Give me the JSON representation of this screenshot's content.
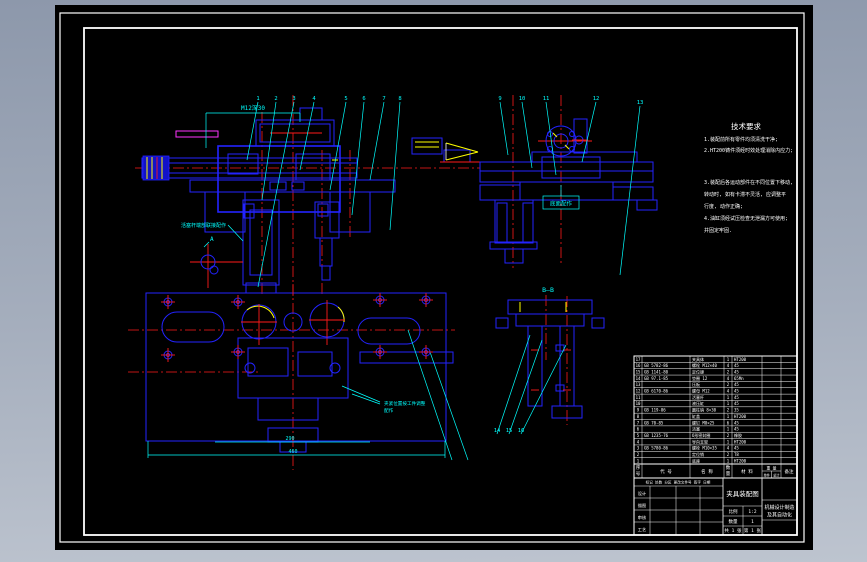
{
  "window": {
    "background_top": "#8d98ab",
    "background_bottom": "#bdc4cf",
    "paper": "#000000"
  },
  "palette": {
    "outline": "#2323ff",
    "centerline": "#ff1a1a",
    "dimension": "#00ffff",
    "highlight": "#ffff00",
    "special": "#ff33ff",
    "frame": "#ffffff",
    "hatch": "#00e0a8"
  },
  "notes": {
    "title": "技术要求",
    "lines": [
      "1.装配前所有零件均须清洗干净;",
      "2.HT200铸件须经时效处理消除内应力;",
      "3.装配后各运动部件在不同位置下移动,",
      "  转动时, 如有卡滞不灵活, 应调整平",
      "  行度, 动作正确;",
      "4.油缸须经试压检查无泄漏方可使用;",
      "  并固定牢固."
    ]
  },
  "labels": {
    "front_top_dim": "M12深30",
    "front_leader": "活塞杆端部联接配作",
    "detail_mark": "A",
    "section_label": "B—B",
    "side_box": "底面配作",
    "plan_leader_1": "夹紧位置按工件调整",
    "plan_leader_2": "配作",
    "plan_dim_inner": "290",
    "plan_dim_overall": "460"
  },
  "balloons": {
    "front": [
      "1",
      "2",
      "3",
      "4",
      "5",
      "6",
      "7",
      "8"
    ],
    "side": [
      "9",
      "10",
      "11",
      "12",
      "13"
    ],
    "section": [
      "14",
      "15",
      "16"
    ]
  },
  "bom": {
    "headers": [
      "序号",
      "代 号",
      "名 称",
      "数量",
      "材 料",
      "重 量",
      "备注"
    ],
    "weight_sub": [
      "单件",
      "总计"
    ],
    "rows": [
      [
        "17",
        "",
        "夹具体",
        "1",
        "HT200",
        ""
      ],
      [
        "16",
        "GB 5782-86",
        "螺栓 M12×40",
        "4",
        "45",
        ""
      ],
      [
        "15",
        "GB 1141-80",
        "定位键",
        "2",
        "45",
        ""
      ],
      [
        "14",
        "GB 97.1-85",
        "垫圈 12",
        "4",
        "65Mn",
        ""
      ],
      [
        "13",
        "",
        "压板",
        "2",
        "45",
        ""
      ],
      [
        "12",
        "GB 6170-86",
        "螺母 M12",
        "4",
        "45",
        ""
      ],
      [
        "11",
        "",
        "活塞杆",
        "1",
        "45",
        ""
      ],
      [
        "10",
        "",
        "液压缸",
        "1",
        "45",
        ""
      ],
      [
        "9",
        "GB 119-86",
        "圆柱销 8×30",
        "2",
        "35",
        ""
      ],
      [
        "8",
        "",
        "缸盖",
        "1",
        "HT200",
        ""
      ],
      [
        "7",
        "GB 70-85",
        "螺钉 M8×25",
        "6",
        "45",
        ""
      ],
      [
        "6",
        "",
        "活塞",
        "1",
        "45",
        ""
      ],
      [
        "5",
        "GB 1235-76",
        "O形密封圈",
        "2",
        "橡胶",
        ""
      ],
      [
        "4",
        "",
        "导向支架",
        "1",
        "HT200",
        ""
      ],
      [
        "3",
        "GB 5780-86",
        "螺栓 M10×35",
        "4",
        "45",
        ""
      ],
      [
        "2",
        "",
        "定位销",
        "2",
        "T8",
        ""
      ],
      [
        "1",
        "",
        "底座",
        "1",
        "HT200",
        ""
      ]
    ]
  },
  "titleblock": {
    "rev_header": "标记 处数 分区 更改文件号 签字 日期",
    "sign_rows": [
      "设计",
      "描图",
      "审核",
      "工艺"
    ],
    "drawing_title": "夹具装配图",
    "scale_label": "比例",
    "scale": "1:2",
    "qty_label": "数量",
    "qty": "1",
    "sheets": "共 1 张",
    "sheet_no": "第 1 张",
    "org_line1": "机械设计制造",
    "org_line2": "及其自动化"
  }
}
